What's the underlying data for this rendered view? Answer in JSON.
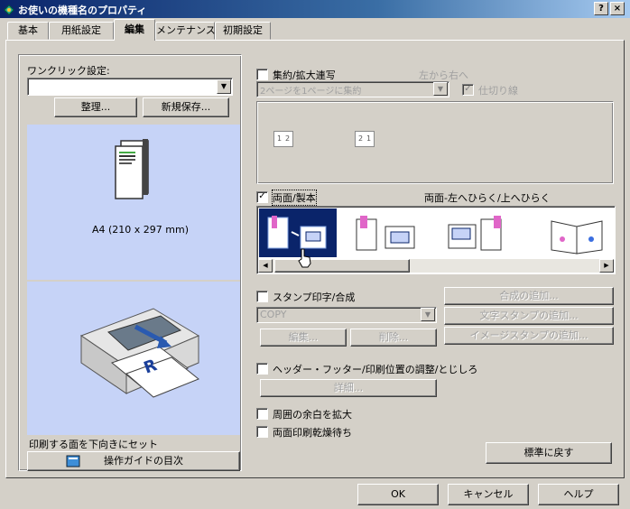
{
  "window": {
    "title": "お使いの機種名のプロパティ",
    "help_btn": "?",
    "close_btn": "×"
  },
  "tabs": [
    {
      "label": "基本"
    },
    {
      "label": "用紙設定"
    },
    {
      "label": "編集"
    },
    {
      "label": "メンテナンス"
    },
    {
      "label": "初期設定"
    }
  ],
  "left": {
    "one_click_label": "ワンクリック設定:",
    "one_click_value": "",
    "organize_btn": "整理...",
    "new_save_btn": "新規保存...",
    "paper_size_text": "A4 (210 x 297 mm)",
    "print_instruction": "印刷する面を下向きにセット",
    "guide_btn": "操作ガイドの目次"
  },
  "combine": {
    "checkbox_label": "集約/拡大連写",
    "checked": false,
    "order_label": "左から右へ",
    "select_value": "2ページを1ページに集約",
    "separator_label": "仕切り線",
    "separator_checked": true,
    "pages_a": [
      "1",
      "2"
    ],
    "pages_b": [
      "2",
      "1"
    ]
  },
  "duplex": {
    "checkbox_label": "両面/製本",
    "checked": true,
    "mode_text": "両面-左へひらく/上へひらく",
    "options": [
      {
        "name": "duplex-left-open",
        "selected": true
      },
      {
        "name": "duplex-top-open",
        "selected": false
      },
      {
        "name": "booklet-left",
        "selected": false
      },
      {
        "name": "booklet-right",
        "selected": false
      },
      {
        "name": "booklet-open",
        "selected": false
      }
    ]
  },
  "stamp": {
    "checkbox_label": "スタンプ印字/合成",
    "checked": false,
    "select_value": "COPY",
    "edit_btn": "編集...",
    "delete_btn": "削除...",
    "add_overlay_btn": "合成の追加...",
    "add_text_stamp_btn": "文字スタンプの追加...",
    "add_image_stamp_btn": "イメージスタンプの追加..."
  },
  "header_footer": {
    "checkbox_label": "ヘッダー・フッター/印刷位置の調整/とじしろ",
    "checked": false,
    "details_btn": "詳細..."
  },
  "margin": {
    "checkbox_label": "周囲の余白を拡大",
    "checked": false
  },
  "wait": {
    "checkbox_label": "両面印刷乾燥待ち",
    "checked": false
  },
  "restore_btn": "標準に戻す",
  "footer": {
    "ok": "OK",
    "cancel": "キャンセル",
    "help": "ヘルプ"
  },
  "colors": {
    "title_start": "#0a246a",
    "selection": "#0a246a",
    "preview_bg": "#c6d3f7"
  }
}
